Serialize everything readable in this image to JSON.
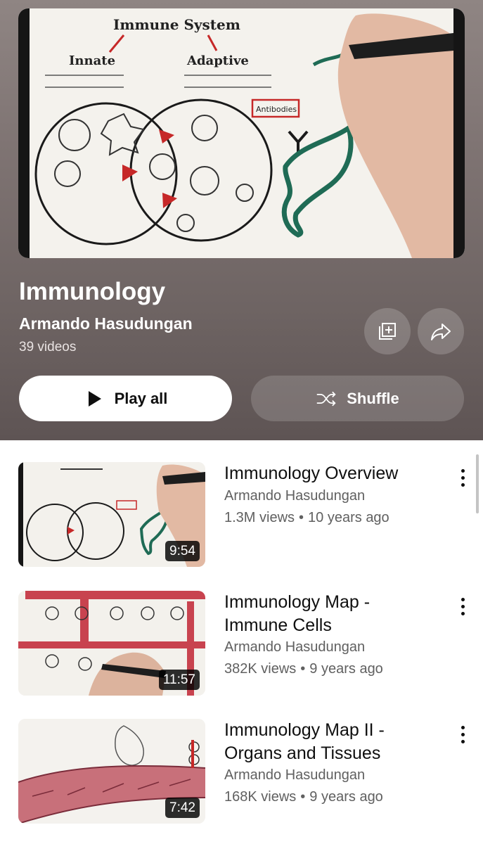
{
  "playlist": {
    "title": "Immunology",
    "channel": "Armando Hasudungan",
    "video_count": "39 videos",
    "play_all_label": "Play all",
    "shuffle_label": "Shuffle"
  },
  "hero_art": {
    "heading": "Immune System",
    "innate": "Innate",
    "adaptive": "Adaptive",
    "antibodies": "Antibodies"
  },
  "videos": [
    {
      "title": "Immunology Overview",
      "channel": "Armando Hasudungan",
      "views": "1.3M views",
      "age": "10 years ago",
      "duration": "9:54"
    },
    {
      "title": "Immunology Map - Immune Cells",
      "channel": "Armando Hasudungan",
      "views": "382K views",
      "age": "9 years ago",
      "duration": "11:57"
    },
    {
      "title": "Immunology Map II - Organs and Tissues",
      "channel": "Armando Hasudungan",
      "views": "168K views",
      "age": "9 years ago",
      "duration": "7:42"
    }
  ],
  "icons": {
    "save": "playlist-add-icon",
    "share": "share-icon",
    "play": "play-icon",
    "shuffle": "shuffle-icon",
    "menu": "more-vertical-icon"
  },
  "colors": {
    "header_gradient_top": "#8f8583",
    "header_gradient_bottom": "#5e5454",
    "text_primary": "#0f0f0f",
    "text_secondary": "#606060",
    "antibody_red": "#c62828",
    "pathogen_green": "#1f6b55"
  }
}
